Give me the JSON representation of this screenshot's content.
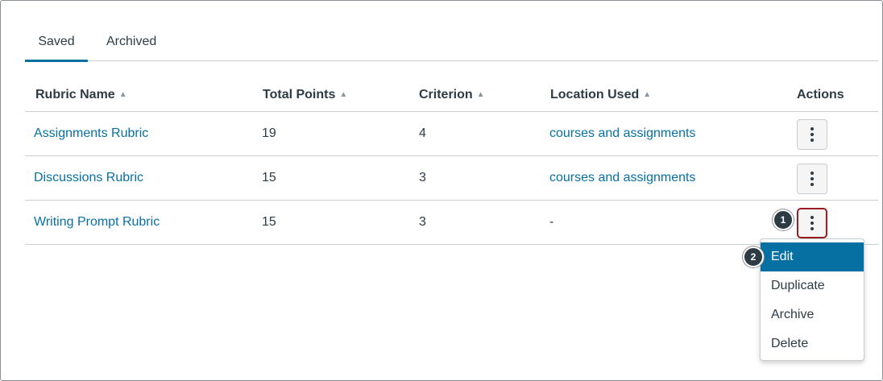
{
  "tabs": {
    "saved": "Saved",
    "archived": "Archived"
  },
  "columns": {
    "name": "Rubric Name",
    "points": "Total Points",
    "criterion": "Criterion",
    "location": "Location Used",
    "actions": "Actions"
  },
  "rows": [
    {
      "name": "Assignments Rubric",
      "points": "19",
      "criterion": "4",
      "location": "courses and assignments"
    },
    {
      "name": "Discussions Rubric",
      "points": "15",
      "criterion": "3",
      "location": "courses and assignments"
    },
    {
      "name": "Writing Prompt Rubric",
      "points": "15",
      "criterion": "3",
      "location": "-"
    }
  ],
  "menu": {
    "edit": "Edit",
    "duplicate": "Duplicate",
    "archive": "Archive",
    "delete": "Delete"
  },
  "callouts": {
    "one": "1",
    "two": "2"
  },
  "icons": {
    "sort": "sort-arrows-icon",
    "kebab": "more-options-icon"
  },
  "colors": {
    "link": "#0770a3",
    "highlight": "#0770a3",
    "callout_border": "#9e1c24"
  }
}
